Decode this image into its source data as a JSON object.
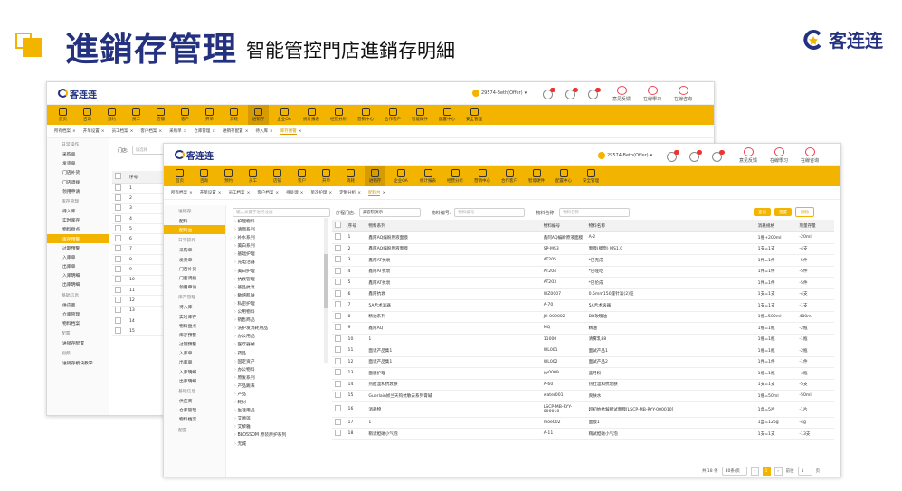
{
  "header": {
    "title": "進銷存管理",
    "subtitle": "智能管控門店進銷存明細",
    "brand": "客连连",
    "colors": {
      "accent": "#f3b400",
      "navy": "#24317e"
    }
  },
  "app": {
    "logo": "客连连",
    "user": "29574-Beth(Offer)",
    "top_links": [
      "意见反馈",
      "在線學习",
      "在線咨询"
    ],
    "nav": [
      "首页",
      "咨询",
      "预约",
      "员工",
      "店铺",
      "客户",
      "开单",
      "消耗",
      "进销存",
      "企业OA",
      "统计报表",
      "经营分析",
      "营销中心",
      "合作客户",
      "智能硬件",
      "配置中心",
      "安全管理"
    ]
  },
  "back": {
    "tabs": [
      "所有档案",
      "开单设置",
      "员工档案",
      "客户档案",
      "采购单",
      "仓库管理",
      "进销存配置",
      "待入库",
      "库存预警"
    ],
    "side": [
      {
        "t": "grp",
        "v": "日常操作"
      },
      {
        "t": "it",
        "v": "采购单"
      },
      {
        "t": "it",
        "v": "发货单"
      },
      {
        "t": "it",
        "v": "门店补货"
      },
      {
        "t": "it",
        "v": "门店调拨"
      },
      {
        "t": "it",
        "v": "领用申请"
      },
      {
        "t": "grp",
        "v": "库存管理"
      },
      {
        "t": "it",
        "v": "待入库"
      },
      {
        "t": "it",
        "v": "实时库存"
      },
      {
        "t": "it",
        "v": "物料盘点"
      },
      {
        "t": "it",
        "v": "库存预警",
        "on": true
      },
      {
        "t": "it",
        "v": "过期预警"
      },
      {
        "t": "it",
        "v": "入库单"
      },
      {
        "t": "it",
        "v": "出库单"
      },
      {
        "t": "it",
        "v": "入库明细"
      },
      {
        "t": "it",
        "v": "出库明细"
      },
      {
        "t": "grp",
        "v": "基础信息"
      },
      {
        "t": "it",
        "v": "供应商"
      },
      {
        "t": "it",
        "v": "仓库管理"
      },
      {
        "t": "it",
        "v": "物料档案"
      },
      {
        "t": "grp",
        "v": "配置"
      },
      {
        "t": "it",
        "v": "进销存配置"
      },
      {
        "t": "grp",
        "v": "视频"
      },
      {
        "t": "it",
        "v": "进销存模块教学"
      }
    ],
    "filter_label": "门店:",
    "filter_placeholder": "请选择",
    "col_index": "序号",
    "rows": [
      "1",
      "2",
      "3",
      "4",
      "5",
      "6",
      "7",
      "8",
      "9",
      "10",
      "11",
      "12",
      "13",
      "14",
      "15"
    ]
  },
  "front": {
    "tabs": [
      "所有档案",
      "开单设置",
      "员工档案",
      "客户档案",
      "待处理",
      "单次护理",
      "定制分析",
      "配料台"
    ],
    "side": [
      {
        "t": "grp",
        "v": "进销存"
      },
      {
        "t": "it",
        "v": "配料"
      },
      {
        "t": "it",
        "v": "配料台",
        "on": true
      },
      {
        "t": "grp",
        "v": "日常操作"
      },
      {
        "t": "it",
        "v": "采购单"
      },
      {
        "t": "it",
        "v": "发货单"
      },
      {
        "t": "it",
        "v": "门店补货"
      },
      {
        "t": "it",
        "v": "门店调拨"
      },
      {
        "t": "it",
        "v": "领用申请"
      },
      {
        "t": "grp",
        "v": "库存管理"
      },
      {
        "t": "it",
        "v": "待入库"
      },
      {
        "t": "it",
        "v": "实时库存"
      },
      {
        "t": "it",
        "v": "物料盘点"
      },
      {
        "t": "it",
        "v": "库存预警"
      },
      {
        "t": "it",
        "v": "过期预警"
      },
      {
        "t": "it",
        "v": "入库单"
      },
      {
        "t": "it",
        "v": "出库单"
      },
      {
        "t": "it",
        "v": "入库明细"
      },
      {
        "t": "it",
        "v": "出库明细"
      },
      {
        "t": "grp",
        "v": "基础信息"
      },
      {
        "t": "it",
        "v": "供应商"
      },
      {
        "t": "it",
        "v": "仓库管理"
      },
      {
        "t": "it",
        "v": "物料档案"
      },
      {
        "t": "grp",
        "v": "配置"
      }
    ],
    "tree_search": "输入关键字进行过滤",
    "tree": [
      "护理物料",
      "清面系列",
      "补水系列",
      "美白系列",
      "基础护理",
      "充电活器",
      "美白护理",
      "抗衰管理",
      "基品抗衰",
      "敏感肌肤",
      "私密护理",
      "公用物料",
      "销售商品",
      "洗护发消耗用品",
      "办公用品",
      "医疗器械",
      "药品",
      "固定资产",
      "办公物料",
      "原发系列",
      "产品跳表",
      "产品",
      "耗材",
      "生活用品",
      "艾德莲",
      "艾黎雅",
      "BLOSSOM 原装原护系列",
      "无城"
    ],
    "filter": {
      "l1": "疗程门店:",
      "v1": "美容院演示",
      "l2": "物料编号:",
      "p2": "物料编号",
      "l3": "物料名称:",
      "p3": "物料名称"
    },
    "buttons": [
      "查询",
      "重置",
      "删除"
    ],
    "cols": [
      "序号",
      "物料系列",
      "物料编号",
      "物料名称",
      "消耗规格",
      "剂量存量"
    ],
    "rows": [
      [
        "1",
        "鑫阿AQ编盼原液面膜",
        "鑫阿AQ编盼原液面膜",
        "A-2",
        "1瓶+200ml",
        "-20ml"
      ],
      [
        "2",
        "鑫阿AQ编盼原液面膜",
        "SP-MS3",
        "面膜(膜面) MS1.0",
        "1支=1支",
        "-4支"
      ],
      [
        "3",
        "鑫阿AT抗衰",
        "AT205",
        "*巴克成",
        "1件=1件",
        "-5件"
      ],
      [
        "4",
        "鑫阿AT抗衰",
        "AT204",
        "*巴哑吃",
        "1件=1件",
        "-5件"
      ],
      [
        "5",
        "鑫阿AT抗衰",
        "AT203",
        "*巴伦成",
        "1件=1件",
        "-5件"
      ],
      [
        "6",
        "鑫阿抗衰",
        "WZ0007",
        "0.5mm150座针滚(2)证",
        "1支=1支",
        "-4支"
      ],
      [
        "7",
        "5A舌术滚器",
        "A-70",
        "5A舌术滚器",
        "1支=1支",
        "-1支"
      ],
      [
        "8",
        "精油系列",
        "JH-000002",
        "DR玫瑰油",
        "1瓶=500ml",
        "480ml"
      ],
      [
        "9",
        "鑫阿AQ",
        "MQ",
        "精油",
        "1瓶=1瓶",
        "-2瓶"
      ],
      [
        "10",
        "1",
        "11000",
        "清雾乳88",
        "1瓶=1瓶",
        "-1瓶"
      ],
      [
        "11",
        "面试产品集1",
        "WL001",
        "面试产品1",
        "1瓶=1瓶",
        "-2瓶"
      ],
      [
        "12",
        "面试产品集1",
        "WL002",
        "面试产品2",
        "1件=1件",
        "-1件"
      ],
      [
        "13",
        "面膜护理",
        "yy0009",
        "蓝月粉",
        "1瓶=1瓶",
        "-4瓶"
      ],
      [
        "14",
        "热肚温和抗衰肤",
        "A-60",
        "热肚温和抗衰肤",
        "1支=1支",
        "-5支"
      ],
      [
        "15",
        "Guerlain娇兰天钩抗敏去系列膏碱",
        "water001",
        "爽肤水",
        "1瓶=50ml",
        "-50ml"
      ],
      [
        "16",
        "消耗物",
        "LSCP-MB-RYY-000010",
        "超初始抗皱膜试面膜[LSCP-MB-RYY-000010]",
        "1盒=5片",
        "-1片"
      ],
      [
        "17",
        "1",
        "moe002",
        "面膜1",
        "1盒=125g",
        "-4g"
      ],
      [
        "18",
        "鞘试妲磁小气泡",
        "A-11",
        "鞘试妲磁小气泡",
        "1支=1支",
        "-13支"
      ]
    ],
    "pager": {
      "total": "共 18 条",
      "size": "40条/页",
      "page": "1",
      "goto": "前往",
      "goto_val": "1",
      "unit": "页"
    }
  },
  "watermark": "29574-Beth(Offer)"
}
